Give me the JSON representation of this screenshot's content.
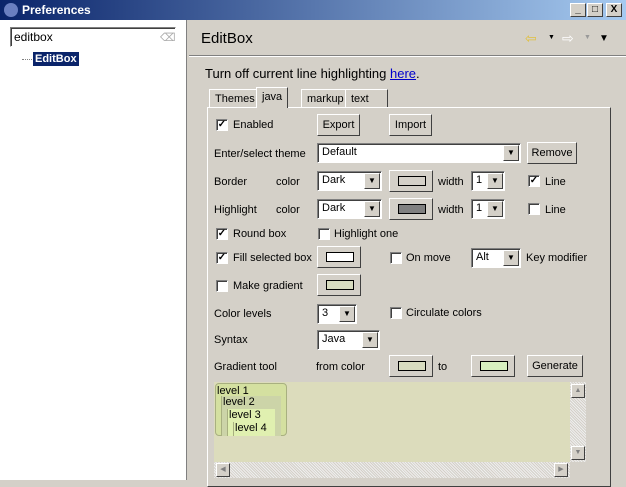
{
  "window": {
    "title": "Preferences",
    "minimize": "_",
    "maximize": "□",
    "close": "X"
  },
  "sidebar": {
    "filter_value": "editbox",
    "tree": [
      {
        "label": "EditBox",
        "selected": true
      }
    ]
  },
  "header": {
    "title": "EditBox",
    "back_icon": "arrow-left-icon",
    "forward_icon": "arrow-right-icon",
    "menu_icon": "triangle-down-icon"
  },
  "intro": {
    "text": "Turn off current line highlighting ",
    "link": "here",
    "suffix": "."
  },
  "tabs": [
    {
      "label": "Themes"
    },
    {
      "label": "java",
      "active": true
    },
    {
      "label": "markup"
    },
    {
      "label": "text"
    }
  ],
  "form": {
    "enabled": {
      "label": "Enabled",
      "checked": true
    },
    "export": "Export",
    "import": "Import",
    "theme_label": "Enter/select theme",
    "theme_value": "Default",
    "remove": "Remove",
    "border": {
      "label": "Border",
      "color_label": "color",
      "color_value": "Dark",
      "swatch": "#d4d0c8",
      "width_label": "width",
      "width_value": "1",
      "line_label": "Line",
      "line_checked": true
    },
    "highlight": {
      "label": "Highlight",
      "color_label": "color",
      "color_value": "Dark",
      "swatch": "#808080",
      "width_label": "width",
      "width_value": "1",
      "line_label": "Line",
      "line_checked": false
    },
    "round_box": {
      "label": "Round box",
      "checked": true
    },
    "highlight_one": {
      "label": "Highlight one",
      "checked": false
    },
    "fill_selected": {
      "label": "Fill selected box",
      "checked": true,
      "swatch": "#ffffff"
    },
    "on_move": {
      "label": "On move",
      "checked": false
    },
    "key_value": "Alt",
    "key_modifier": "Key modifier",
    "make_gradient": {
      "label": "Make gradient",
      "checked": false,
      "swatch": "#d8dcc0"
    },
    "color_levels_label": "Color levels",
    "color_levels_value": "3",
    "circulate": {
      "label": "Circulate colors",
      "checked": false
    },
    "syntax_label": "Syntax",
    "syntax_value": "Java",
    "gradient_tool": "Gradient tool",
    "from_color": "from color",
    "from_swatch": "#d8dcc0",
    "to": "to",
    "to_swatch": "#d8f0c0",
    "generate": "Generate"
  },
  "preview": {
    "levels": [
      "level 1",
      "level 2",
      "level 3",
      "level 4"
    ]
  }
}
